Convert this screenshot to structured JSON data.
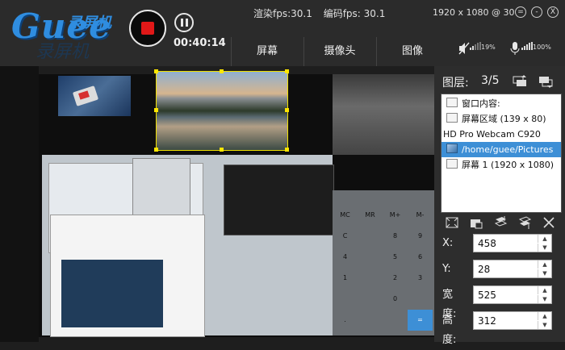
{
  "app": {
    "logo_text": "Guee",
    "logo_sub": "录屏机",
    "logo_ghost": "录屏机",
    "timer": "00:40:14",
    "render_fps": "渲染fps:30.1",
    "encode_fps": "编码fps: 30.1",
    "resolution_info": "1920 x 1080 @ 30",
    "min_label": "=",
    "restore_label": "-",
    "close_label": "X"
  },
  "tabs": [
    {
      "label": "屏幕"
    },
    {
      "label": "摄像头"
    },
    {
      "label": "图像"
    }
  ],
  "audio": {
    "speaker_level": "19%",
    "mic_level": "100%"
  },
  "layers": {
    "title": "图层:",
    "count": "3/5",
    "items": [
      {
        "label": "窗口内容:"
      },
      {
        "label": "屏幕区域 (139 x 80)"
      },
      {
        "label": "HD Pro Webcam C920"
      },
      {
        "label": "/home/guee/Pictures"
      },
      {
        "label": "屏幕 1 (1920 x 1080)"
      }
    ],
    "selected_index": 3
  },
  "props": {
    "x_label": "X:",
    "x_value": "458",
    "y_label": "Y:",
    "y_value": "28",
    "w_label": "宽度:",
    "w_value": "525",
    "h_label": "高度:",
    "h_value": "312"
  },
  "calc": {
    "keys": [
      "MC",
      "MR",
      "M+",
      "M-",
      "C",
      "",
      "8",
      "9",
      "4",
      "",
      "5",
      "6",
      "1",
      "",
      "2",
      "3",
      "0",
      "",
      ".",
      "="
    ]
  },
  "colors": {
    "accent": "#2f8de0",
    "record": "#e01818",
    "selection": "#3d8fd6",
    "handle": "#ffe600"
  }
}
